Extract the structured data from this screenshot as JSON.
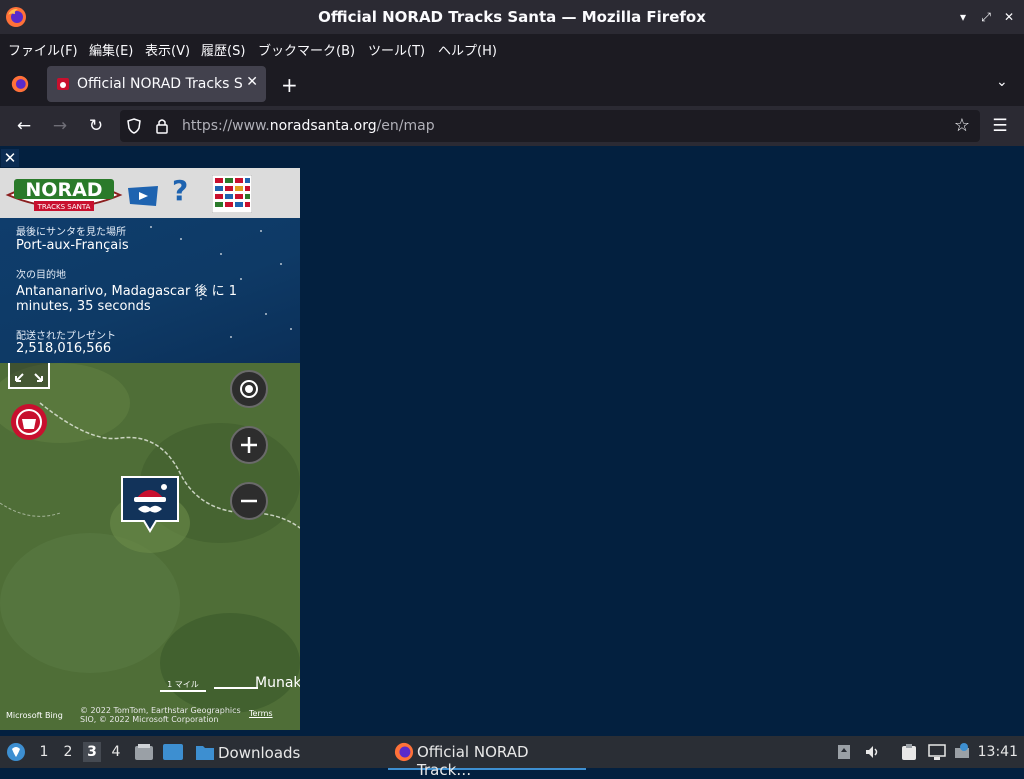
{
  "window": {
    "title": "Official NORAD Tracks Santa — Mozilla Firefox",
    "controls": [
      "minimize",
      "restore",
      "close"
    ]
  },
  "menubar": {
    "items": [
      "ファイル(F)",
      "編集(E)",
      "表示(V)",
      "履歴(S)",
      "ブックマーク(B)",
      "ツール(T)",
      "ヘルプ(H)"
    ]
  },
  "tabs": [
    {
      "label": "Official NORAD Tracks Santa",
      "active": true
    }
  ],
  "navbar": {
    "url_prefix": "https://www.",
    "url_domain": "noradsanta.org",
    "url_path": "/en/map"
  },
  "tracker": {
    "last_seen_label": "最後にサンタを見た場所",
    "last_seen_value": "Port-aux-Français",
    "next_stop_label": "次の目的地",
    "next_stop_line1": "Antananarivo, Madagascar 後 に 1",
    "next_stop_line2": "minutes, 35 seconds",
    "gifts_label": "配送されたプレゼント",
    "gifts_value": "2,518,016,566"
  },
  "map": {
    "scale_label": "1 マイル",
    "place_label": "Munak",
    "bing_label": "Microsoft Bing",
    "attribution_line1": "© 2022 TomTom, Earthstar Geographics",
    "attribution_line2": "SIO, © 2022 Microsoft Corporation",
    "terms_label": "Terms"
  },
  "taskbar": {
    "workspaces": [
      "1",
      "2",
      "3",
      "4"
    ],
    "active_workspace": "3",
    "downloads_label": "Downloads",
    "task_label": "Official NORAD Track…",
    "clock": "13:41"
  },
  "colors": {
    "page_background": "#03203f",
    "info_panel": "#0e3a66",
    "chrome_dark": "#1c1b22",
    "chrome_mid": "#2b2a33"
  }
}
